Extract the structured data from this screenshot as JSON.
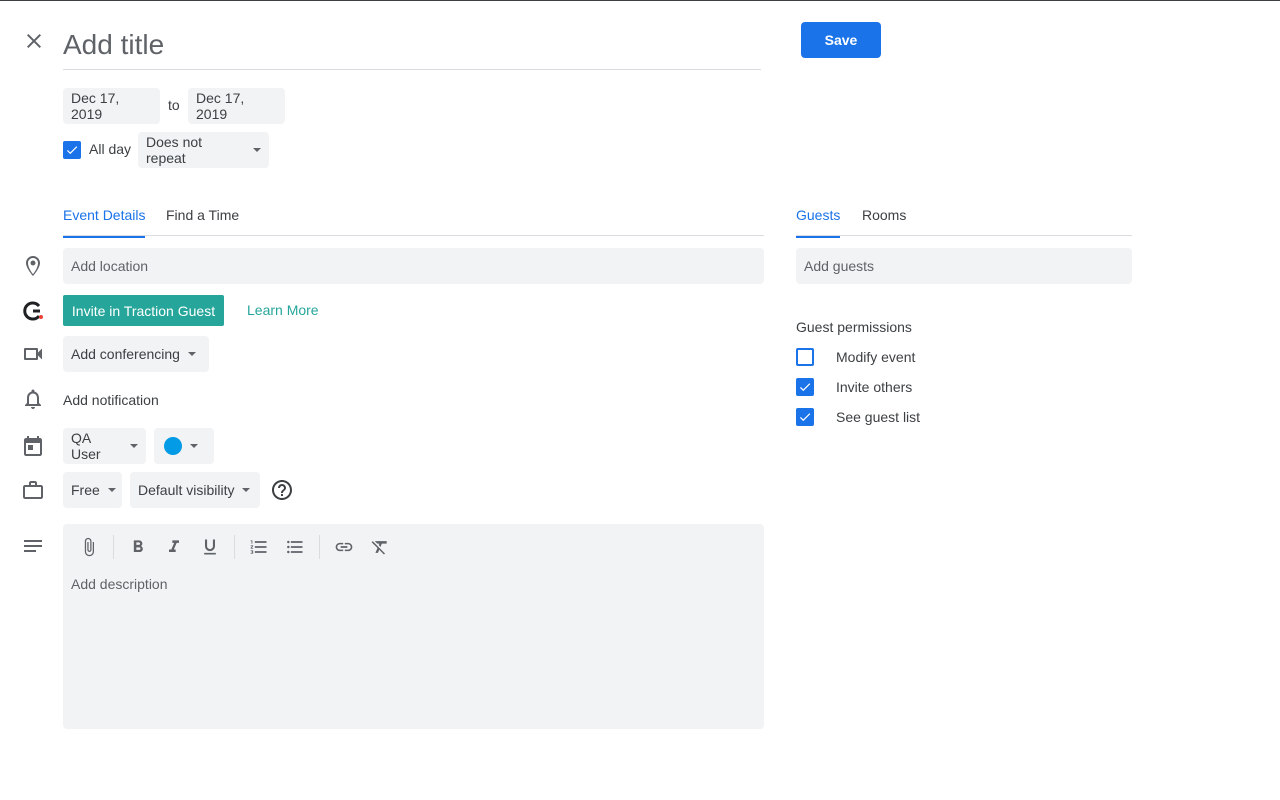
{
  "header": {
    "title_placeholder": "Add title",
    "save_label": "Save"
  },
  "dates": {
    "start": "Dec 17, 2019",
    "separator": "to",
    "end": "Dec 17, 2019"
  },
  "all_day": {
    "label": "All day",
    "checked": true
  },
  "repeat": {
    "selected": "Does not repeat"
  },
  "left_tabs": [
    {
      "label": "Event Details",
      "active": true
    },
    {
      "label": "Find a Time",
      "active": false
    }
  ],
  "right_tabs": [
    {
      "label": "Guests",
      "active": true
    },
    {
      "label": "Rooms",
      "active": false
    }
  ],
  "location": {
    "placeholder": "Add location",
    "icon": "location-pin-icon"
  },
  "traction": {
    "button_label": "Invite in Traction Guest",
    "learn_more": "Learn More",
    "icon": "traction-logo-icon"
  },
  "conferencing": {
    "selected": "Add conferencing",
    "icon": "video-camera-icon"
  },
  "notification": {
    "label": "Add notification",
    "icon": "bell-icon"
  },
  "calendar": {
    "selected": "QA User",
    "color": "#039be5",
    "icon": "calendar-icon"
  },
  "availability": {
    "selected": "Free",
    "visibility": "Default visibility",
    "icon": "briefcase-icon",
    "help_icon": "help-circle-icon"
  },
  "description": {
    "placeholder": "Add description",
    "icon": "description-lines-icon",
    "toolbar": [
      "attachment-icon",
      "bold-icon",
      "italic-icon",
      "underline-icon",
      "numbered-list-icon",
      "bulleted-list-icon",
      "link-icon",
      "clear-formatting-icon"
    ]
  },
  "guests": {
    "placeholder": "Add guests",
    "permissions_title": "Guest permissions",
    "permissions": [
      {
        "label": "Modify event",
        "checked": false
      },
      {
        "label": "Invite others",
        "checked": true
      },
      {
        "label": "See guest list",
        "checked": true
      }
    ]
  },
  "colors": {
    "accent": "#1a73e8",
    "traction": "#26a69a",
    "field_bg": "#f1f3f4"
  }
}
